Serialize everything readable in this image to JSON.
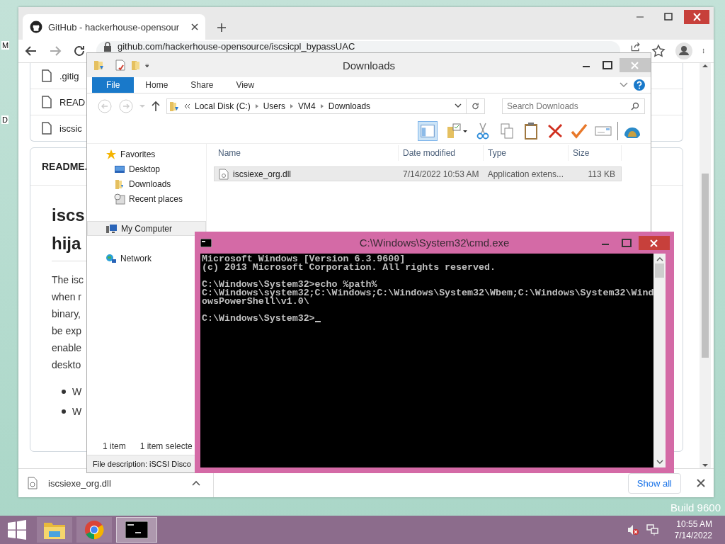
{
  "desktop": {
    "icon_labels": [
      "M",
      "D"
    ],
    "build_text": "Build 9600"
  },
  "browser": {
    "tabs": [
      {
        "title": "GitHub - hackerhouse-opensour",
        "selected": true
      }
    ],
    "url": "github.com/hackerhouse-opensource/iscsicpl_bypassUAC",
    "files": [
      ".gitig",
      "READ",
      "iscsic"
    ],
    "readme_label": "README.",
    "heading_lines": [
      "iscs",
      "hija"
    ],
    "paragraph_lines": [
      "The isc",
      "when r",
      "binary,",
      "be exp",
      "enable",
      "deskto"
    ],
    "bullets": [
      "W",
      "W"
    ],
    "download": {
      "file": "iscsiexe_org.dll",
      "show_all": "Show all"
    }
  },
  "explorer": {
    "title": "Downloads",
    "ribbon_tabs": [
      {
        "label": "File",
        "selected": true
      },
      {
        "label": "Home",
        "selected": false
      },
      {
        "label": "Share",
        "selected": false
      },
      {
        "label": "View",
        "selected": false
      }
    ],
    "breadcrumb": [
      "Local Disk (C:)",
      "Users",
      "VM4",
      "Downloads"
    ],
    "search": {
      "placeholder": "Search Downloads"
    },
    "nav": [
      {
        "label": "Favorites",
        "kind": "star",
        "selected": false,
        "children": [
          {
            "label": "Desktop",
            "kind": "desktop",
            "selected": false
          },
          {
            "label": "Downloads",
            "kind": "folder",
            "selected": false
          },
          {
            "label": "Recent places",
            "kind": "recent",
            "selected": false
          }
        ]
      },
      {
        "label": "My Computer",
        "kind": "computer",
        "selected": true
      },
      {
        "label": "Network",
        "kind": "network",
        "selected": false
      }
    ],
    "columns": [
      "Name",
      "Date modified",
      "Type",
      "Size"
    ],
    "rows": [
      {
        "cells": [
          "iscsiexe_org.dll",
          "7/14/2022 10:53 AM",
          "Application extens...",
          "113 KB"
        ],
        "selected": true
      }
    ],
    "status": [
      "1 item",
      "1 item selecte"
    ],
    "description": "File description: iSCSI Disco"
  },
  "cmd": {
    "title": "C:\\Windows\\System32\\cmd.exe",
    "lines": [
      {
        "text": "Microsoft Windows [Version 6.3.9600]",
        "blank_before": false
      },
      {
        "text": "(c) 2013 Microsoft Corporation. All rights reserved.",
        "blank_before": false
      },
      {
        "text": "C:\\Windows\\System32>echo %path%",
        "blank_before": true
      },
      {
        "text": "C:\\Windows\\system32;C:\\Windows;C:\\Windows\\System32\\Wbem;C:\\Windows\\System32\\Wind",
        "blank_before": false
      },
      {
        "text": "owsPowerShell\\v1.0\\",
        "blank_before": false
      },
      {
        "text": "C:\\Windows\\System32>",
        "blank_before": true
      }
    ]
  },
  "taskbar": {
    "apps": [
      {
        "kind": "explorer",
        "selected": false
      },
      {
        "kind": "chrome",
        "selected": false
      },
      {
        "kind": "cmd",
        "selected": true
      }
    ],
    "time": "10:55 AM",
    "date": "7/14/2022"
  }
}
